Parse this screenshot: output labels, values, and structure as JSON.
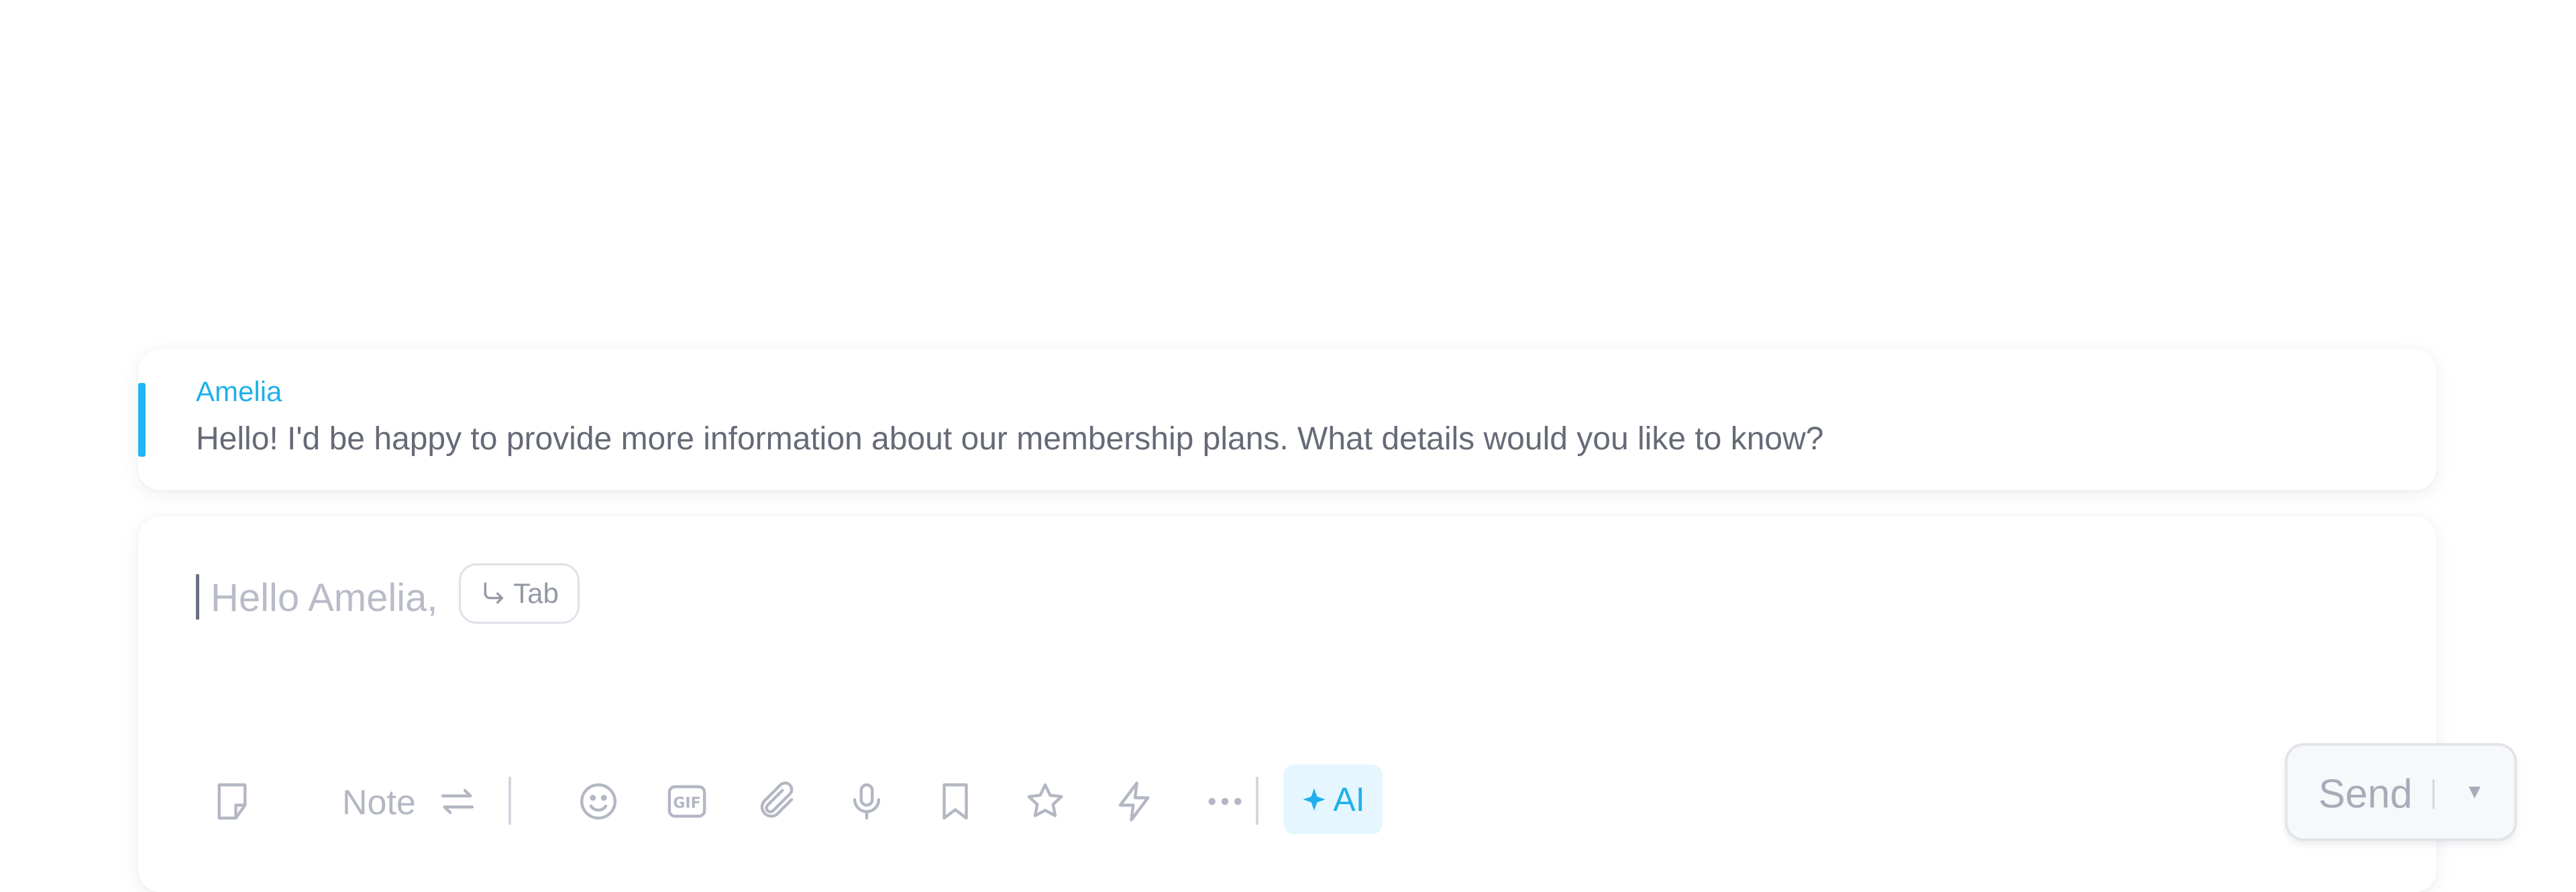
{
  "quoted_message": {
    "author": "Amelia",
    "text": "Hello! I'd be happy to provide more information about our membership plans. What details would you like to know?"
  },
  "composer": {
    "placeholder": "Hello Amelia,",
    "tab_hint": "Tab"
  },
  "toolbar": {
    "note_label": "Note",
    "ai_label": "AI",
    "icons": [
      "note-icon",
      "switch-icon",
      "emoji-icon",
      "gif-icon",
      "attachment-icon",
      "microphone-icon",
      "bookmark-icon",
      "star-icon",
      "lightning-icon",
      "more-icon",
      "sparkle-icon"
    ]
  },
  "send": {
    "label": "Send"
  },
  "colors": {
    "accent": "#22b5f3",
    "muted_icon": "#b3b7c3"
  }
}
